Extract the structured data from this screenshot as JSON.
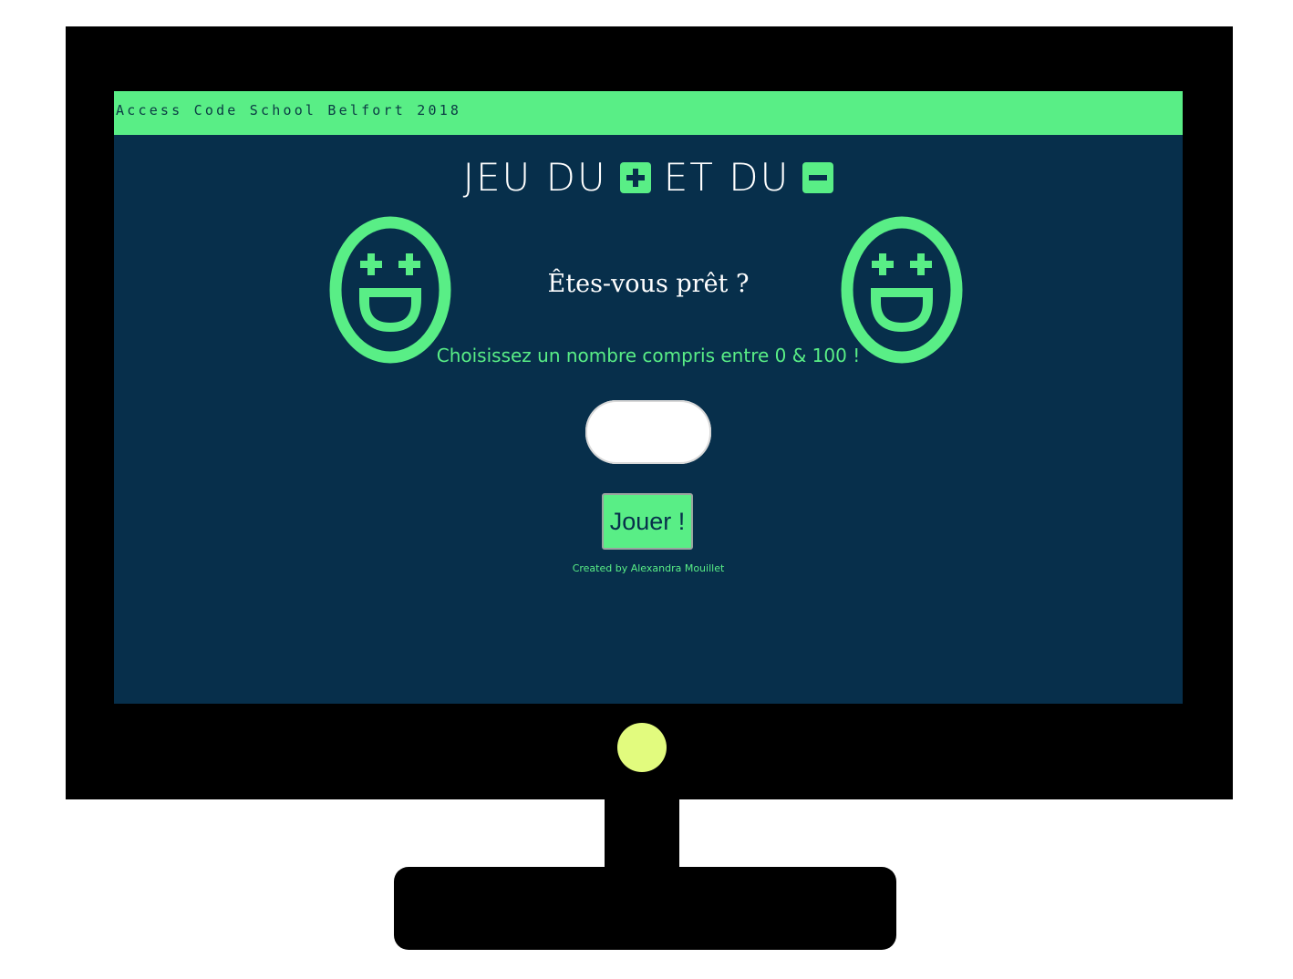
{
  "header": {
    "text": "Access Code School Belfort 2018"
  },
  "title": {
    "part1": "JEU DU",
    "plus_icon": "plus-square-icon",
    "part2": "ET DU",
    "minus_icon": "minus-square-icon"
  },
  "main": {
    "ready_text": "Êtes-vous prêt ?",
    "instruction": "Choisissez un nombre compris entre 0 & 100 !",
    "guess_input": {
      "value": "",
      "placeholder": ""
    },
    "play_button_label": "Jouer !",
    "credit": "Created by Alexandra Mouillet"
  },
  "decorations": {
    "left_face_icon": "smiley-plus-eyes-icon",
    "right_face_icon": "smiley-plus-eyes-icon",
    "power_led_icon": "power-led-icon"
  },
  "colors": {
    "accent_green": "#59ee86",
    "screen_bg": "#072f4b",
    "bezel": "#000000",
    "power_led": "#e2fb7e"
  }
}
